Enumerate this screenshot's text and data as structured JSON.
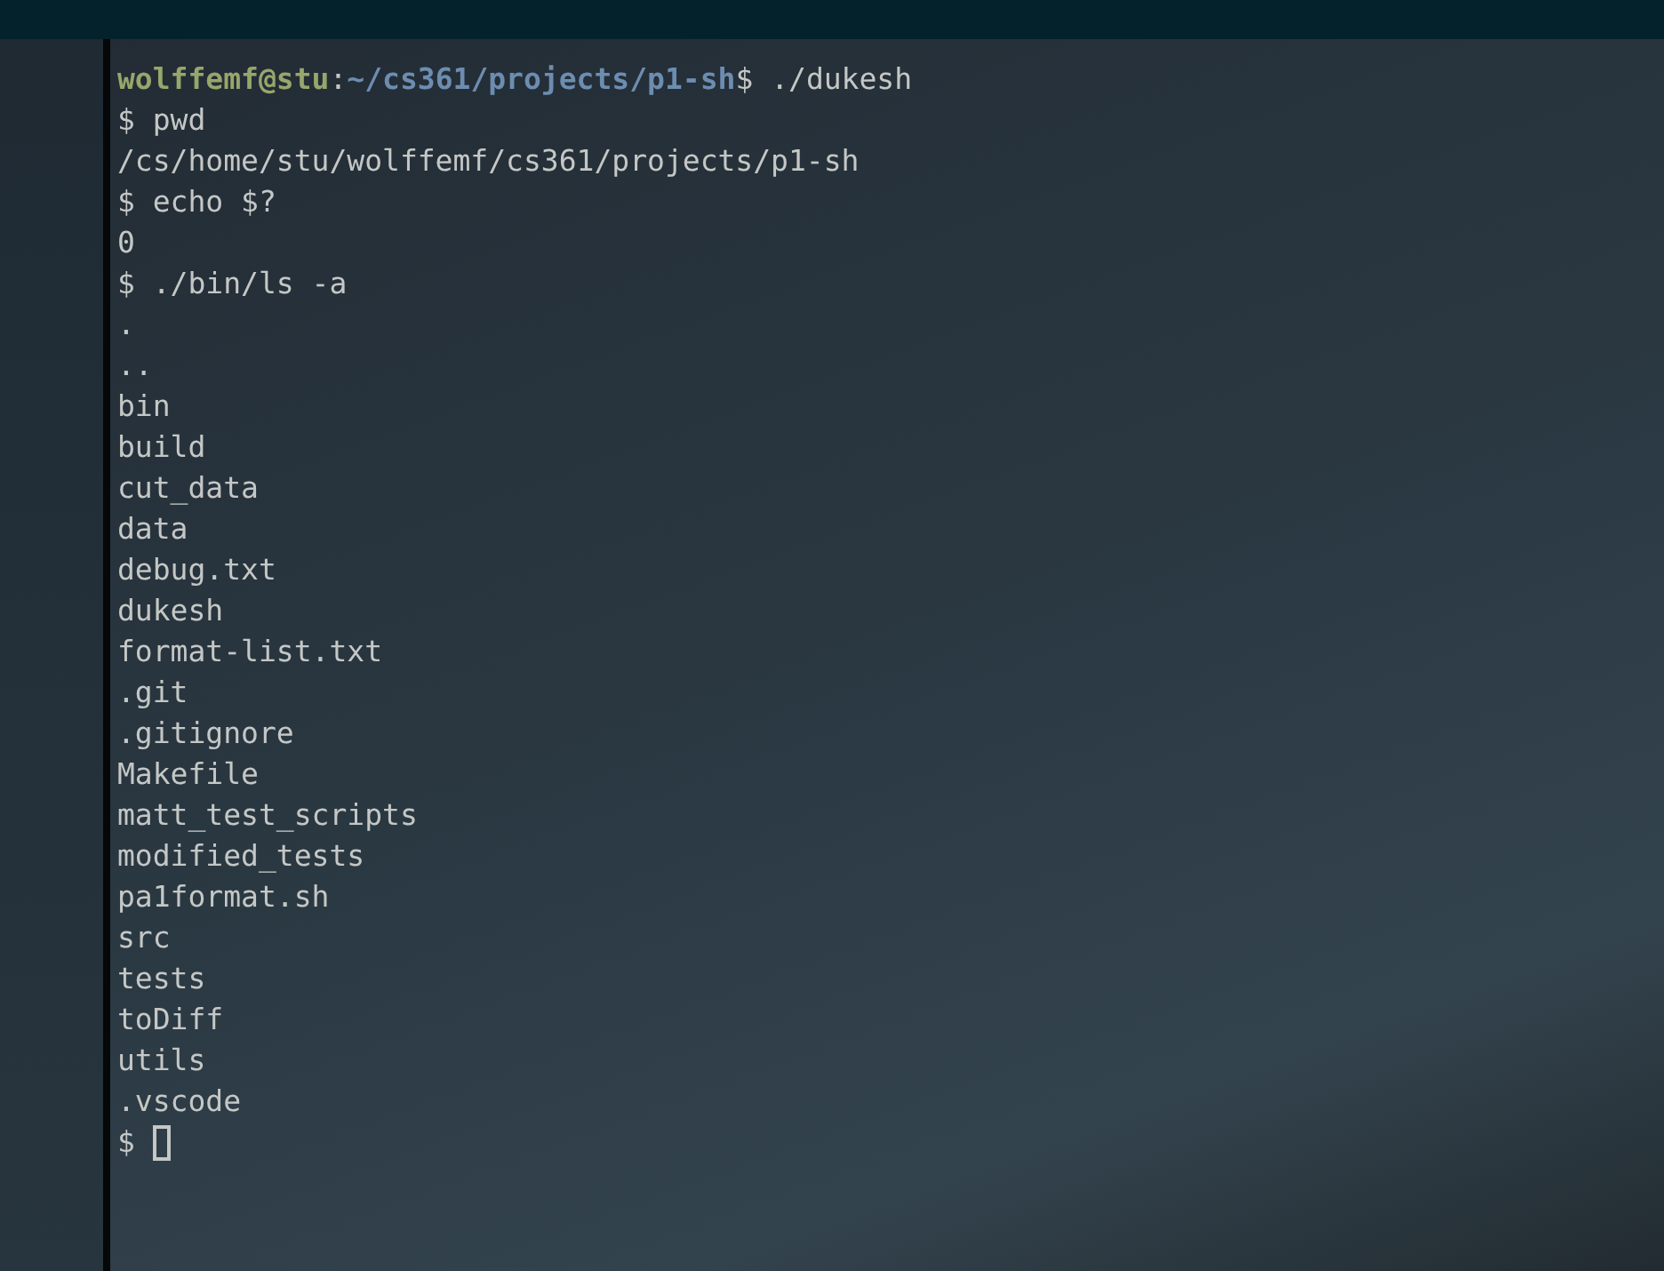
{
  "prompt": {
    "user_host": "wolffemf@stu",
    "separator": ":",
    "path": "~/cs361/projects/p1-sh",
    "command": "$ ./dukesh"
  },
  "lines": [
    "$ pwd",
    "/cs/home/stu/wolffemf/cs361/projects/p1-sh",
    "$ echo $?",
    "0",
    "$ ./bin/ls -a",
    ".",
    "..",
    "bin",
    "build",
    "cut_data",
    "data",
    "debug.txt",
    "dukesh",
    "format-list.txt",
    ".git",
    ".gitignore",
    "Makefile",
    "matt_test_scripts",
    "modified_tests",
    "pa1format.sh",
    "src",
    "tests",
    "toDiff",
    "utils",
    ".vscode"
  ],
  "input_prompt": "$"
}
